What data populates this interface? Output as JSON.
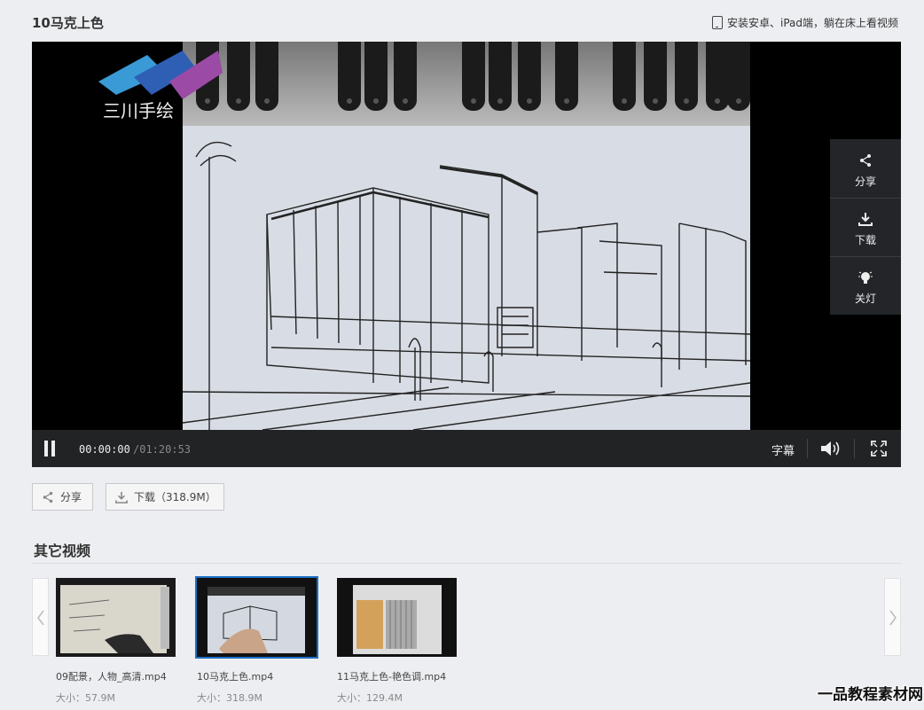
{
  "header": {
    "title": "10马克上色",
    "promo_text": "安装安卓、iPad端，躺在床上看视频"
  },
  "player": {
    "time_current": "00:00:00",
    "time_total": "/01:20:53",
    "subtitle_label": "字幕",
    "side_panel": {
      "share_label": "分享",
      "download_label": "下载",
      "light_label": "关灯"
    },
    "logo_text": "三川手绘"
  },
  "actions": {
    "share_label": "分享",
    "download_label": "下载（318.9M）"
  },
  "related": {
    "title": "其它视频",
    "items": [
      {
        "title": "09配景，人物_高清.mp4",
        "size": "大小：57.9M"
      },
      {
        "title": "10马克上色.mp4",
        "size": "大小：318.9M"
      },
      {
        "title": "11马克上色-艳色调.mp4",
        "size": "大小：129.4M"
      }
    ]
  },
  "watermark": "一品教程素材网",
  "colors": {
    "background": "#edeef1",
    "control_bar": "#212325",
    "selected_outline": "#1c6fc4"
  }
}
